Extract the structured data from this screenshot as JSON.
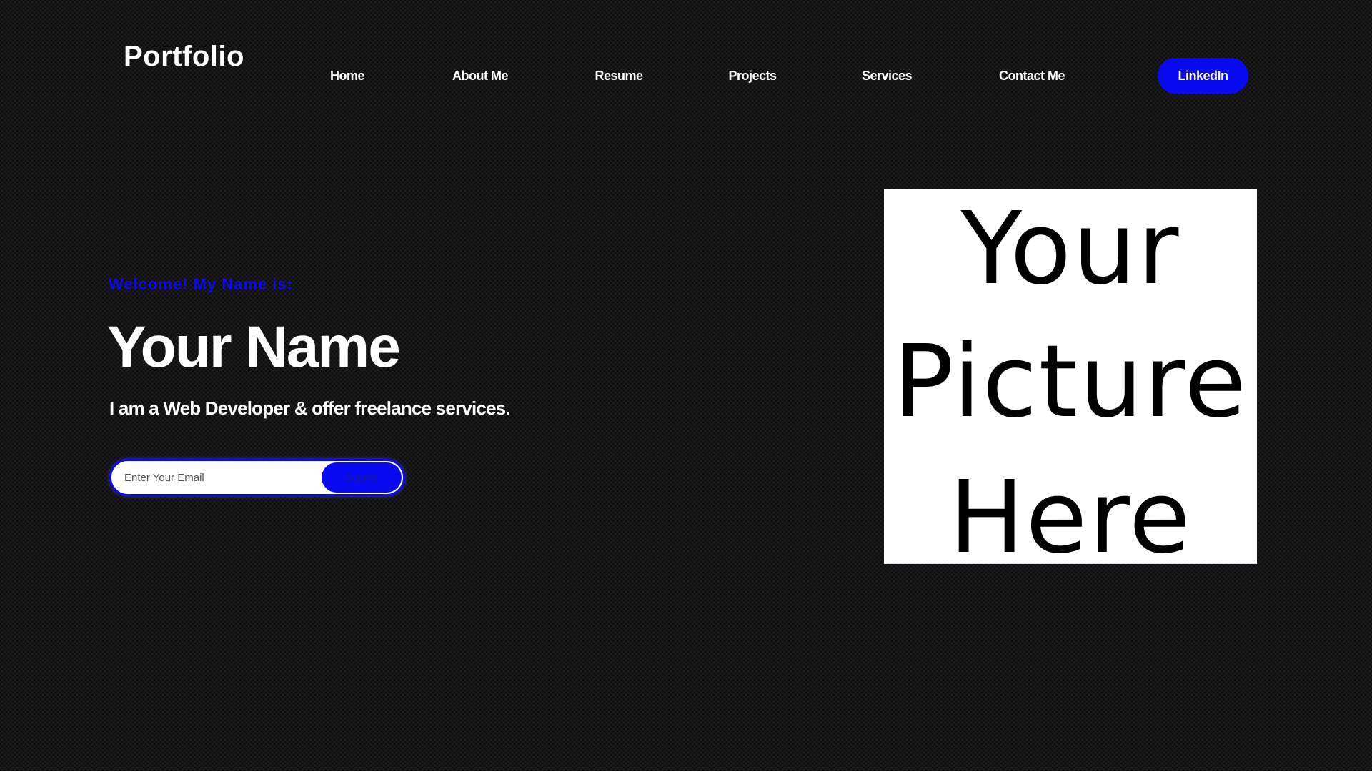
{
  "header": {
    "logo": "Portfolio",
    "nav": [
      {
        "label": "Home",
        "name": "nav-home"
      },
      {
        "label": "About Me",
        "name": "nav-about-me"
      },
      {
        "label": "Resume",
        "name": "nav-resume"
      },
      {
        "label": "Projects",
        "name": "nav-projects"
      },
      {
        "label": "Services",
        "name": "nav-services"
      },
      {
        "label": "Contact Me",
        "name": "nav-contact-me"
      }
    ],
    "linkedin_label": "LinkedIn"
  },
  "hero": {
    "welcome": "Welcome! My Name is:",
    "name": "Your Name",
    "tagline": "I am a Web Developer & offer freelance services.",
    "email": {
      "placeholder": "Enter Your Email",
      "value": "",
      "submit_label": "Submit"
    }
  },
  "picture": {
    "lines": [
      "Your",
      "Picture",
      "Here"
    ]
  },
  "colors": {
    "accent": "#0a0af2",
    "background": "#0b0b0c",
    "text": "#ffffff"
  }
}
